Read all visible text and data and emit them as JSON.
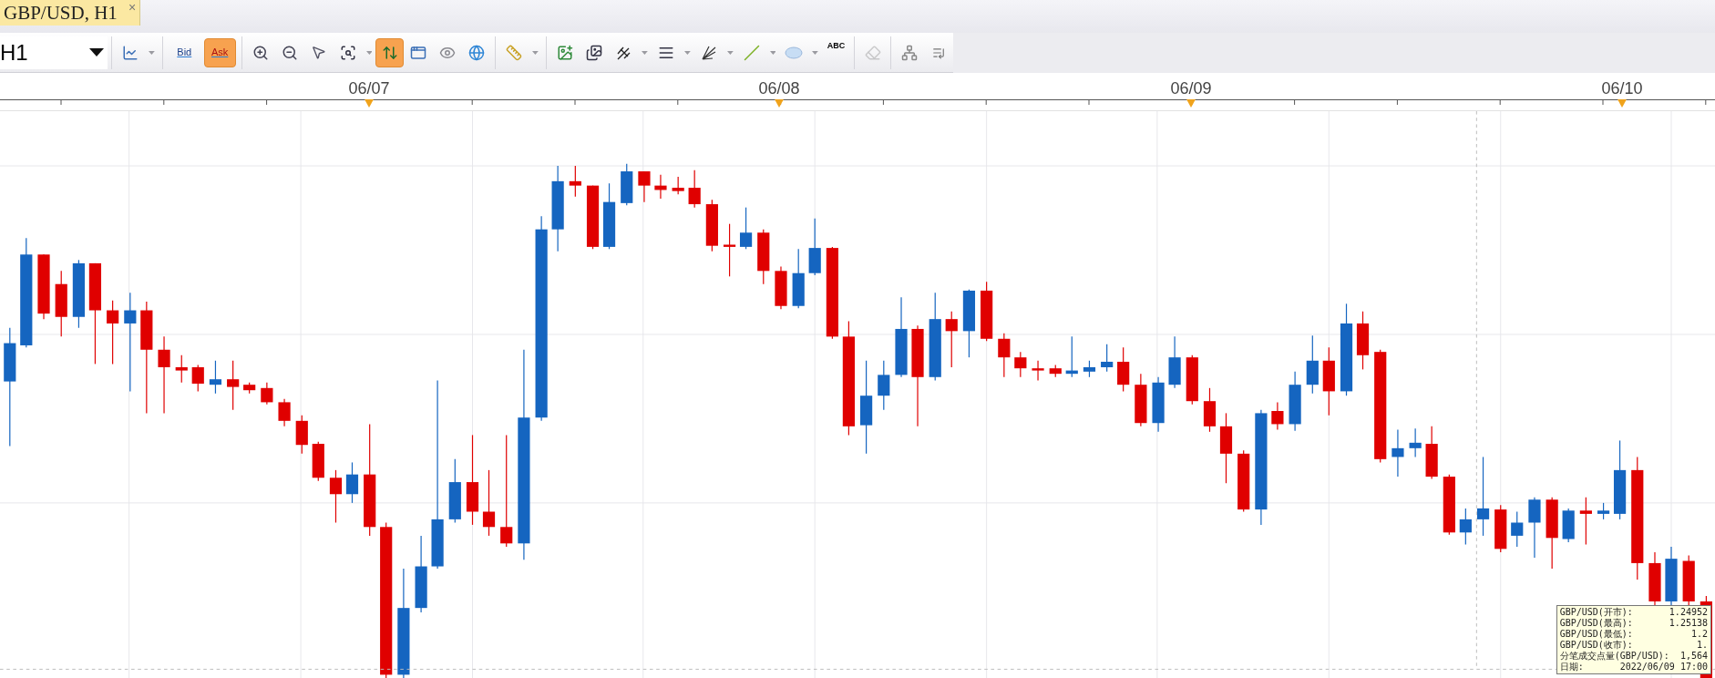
{
  "tabs": [
    {
      "label": "GBP/USD, H1",
      "close": "×",
      "selected": true
    }
  ],
  "toolbar": {
    "timeframe": "H1",
    "price_buttons": [
      {
        "label": "Bid",
        "selected": false
      },
      {
        "label": "Ask",
        "selected": true
      }
    ],
    "auto_scroll": {
      "on": true
    },
    "text_tool": "ABC",
    "eraser": {
      "disabled": true
    }
  },
  "time_axis": {
    "dates": [
      "06/07",
      "06/08",
      "06/09",
      "06/10"
    ]
  },
  "tooltip": {
    "rows": [
      {
        "label": "GBP/USD(开市):",
        "value": "1.24952"
      },
      {
        "label": "GBP/USD(最高):",
        "value": "1.25138"
      },
      {
        "label": "GBP/USD(最低):",
        "value": "1.2"
      },
      {
        "label": "GBP/USD(收市):",
        "value": "1."
      },
      {
        "label": "分笔成交点量(GBP/USD):",
        "value": "1,564"
      },
      {
        "label": "日期:",
        "value": "2022/06/09 17:00"
      }
    ]
  }
}
